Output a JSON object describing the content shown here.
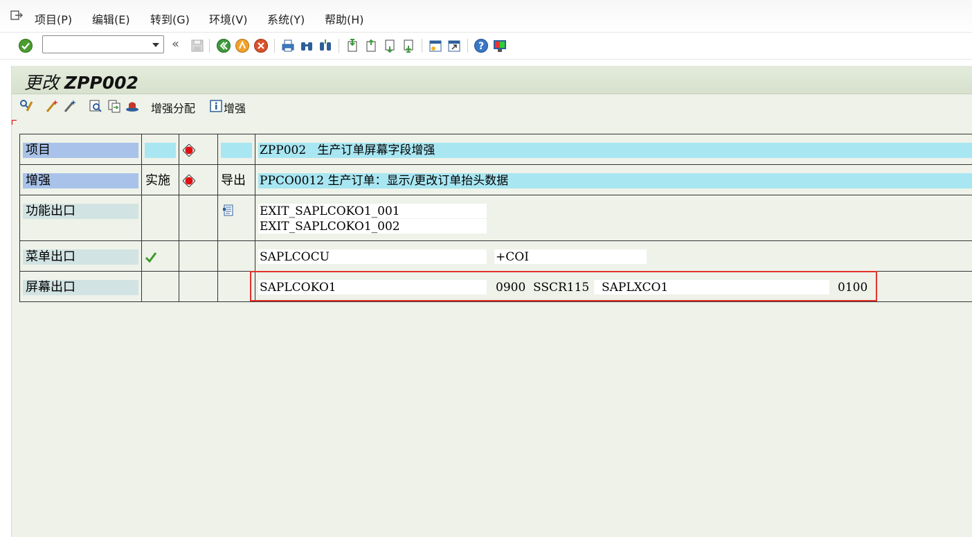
{
  "menubar": {
    "items": [
      {
        "label": "项目(P)"
      },
      {
        "label": "编辑(E)"
      },
      {
        "label": "转到(G)"
      },
      {
        "label": "环境(V)"
      },
      {
        "label": "系统(Y)"
      },
      {
        "label": "帮助(H)"
      }
    ]
  },
  "systoolbar": {
    "command_value": "",
    "back_glyph": "«"
  },
  "title": {
    "prefix": "更改",
    "id": "ZPP002"
  },
  "apptoolbar": {
    "enhancement_assign_label": "增强分配",
    "enhancement_label": "增强"
  },
  "grid": {
    "project": {
      "label": "项目",
      "text": "ZPP002   生产订单屏幕字段增强"
    },
    "enhancement": {
      "label": "增强",
      "status": "实施",
      "export": "导出",
      "text": "PPCO0012 生产订单：显示/更改订单抬头数据"
    },
    "function_exits": {
      "label": "功能出口",
      "items": [
        "EXIT_SAPLCOKO1_001",
        "EXIT_SAPLCOKO1_002"
      ]
    },
    "menu_exits": {
      "label": "菜单出口",
      "program": "SAPLCOCU",
      "code": "+COI"
    },
    "screen_exits": {
      "label": "屏幕出口",
      "program": "SAPLCOKO1",
      "screen": "0900",
      "area": "SSCR115",
      "called_program": "SAPLXCO1",
      "called_screen": "0100"
    }
  },
  "colors": {
    "accent_cyan": "#a8e6f2",
    "label_blue": "#a9c2e9",
    "highlight_red": "#e5312a",
    "status_red": "#e01010",
    "check_green": "#3c9a2a"
  }
}
